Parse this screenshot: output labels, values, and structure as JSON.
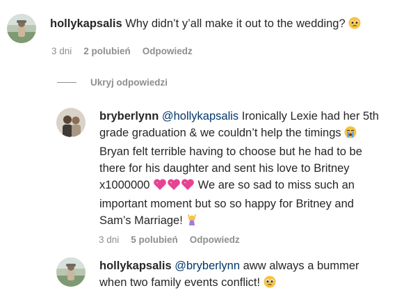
{
  "comments": [
    {
      "username": "hollykapsalis",
      "text": "Why didn’t y’all make it out to the wedding?",
      "emoji": "pleading-face",
      "meta": {
        "time": "3 dni",
        "likes": "2 polubień",
        "reply": "Odpowiedz"
      }
    }
  ],
  "hide_replies_label": "Ukryj odpowiedzi",
  "replies": [
    {
      "username": "bryberlynn",
      "mention": "@hollykapsalis",
      "lines": [
        " Ironically Lexie had her 5th",
        "grade graduation & we couldn’t help the timings",
        "Bryan felt terrible having to choose but he had to be",
        "there for his daughter and sent his love to Britney",
        "x1000000",
        " We are so sad to miss such an",
        "important moment but so so happy for Britney and",
        "Sam’s Marriage!"
      ],
      "meta": {
        "time": "3 dni",
        "likes": "5 polubień",
        "reply": "Odpowiedz"
      }
    },
    {
      "username": "hollykapsalis",
      "mention": "@bryberlynn",
      "lines": [
        " aww always a bummer",
        "when two family events conflict!"
      ],
      "meta": {}
    }
  ],
  "colors": {
    "text": "#262626",
    "secondary": "#8e8e8e",
    "mention": "#00376b",
    "heart": "#e84393"
  }
}
